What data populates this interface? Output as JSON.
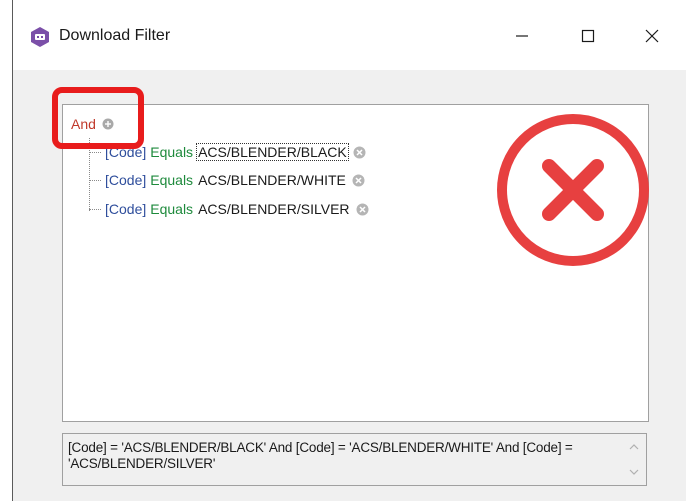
{
  "window": {
    "title": "Download Filter"
  },
  "titlebar": {
    "minimize_glyph": "—",
    "maximize_glyph": "☐",
    "close_glyph": "✕"
  },
  "tree": {
    "root_operator": "And",
    "conditions": [
      {
        "field": "[Code]",
        "operator": "Equals",
        "value": "ACS/BLENDER/BLACK",
        "focused": true
      },
      {
        "field": "[Code]",
        "operator": "Equals",
        "value": "ACS/BLENDER/WHITE",
        "focused": false
      },
      {
        "field": "[Code]",
        "operator": "Equals",
        "value": "ACS/BLENDER/SILVER",
        "focused": false
      }
    ]
  },
  "expression": {
    "text": "[Code] = 'ACS/BLENDER/BLACK' And [Code] = 'ACS/BLENDER/WHITE' And [Code] = 'ACS/BLENDER/SILVER'"
  },
  "colors": {
    "operator_and": "#c0392b",
    "field": "#2f4e9c",
    "operator_equals": "#1e8a3c",
    "annotation_red": "#e81c1c",
    "annotation_x_red": "#e74040"
  },
  "icons": {
    "app": "app-logo-icon",
    "add": "plus-circle-icon",
    "remove": "remove-circle-icon",
    "annotation_x": "red-x-circle-icon"
  }
}
